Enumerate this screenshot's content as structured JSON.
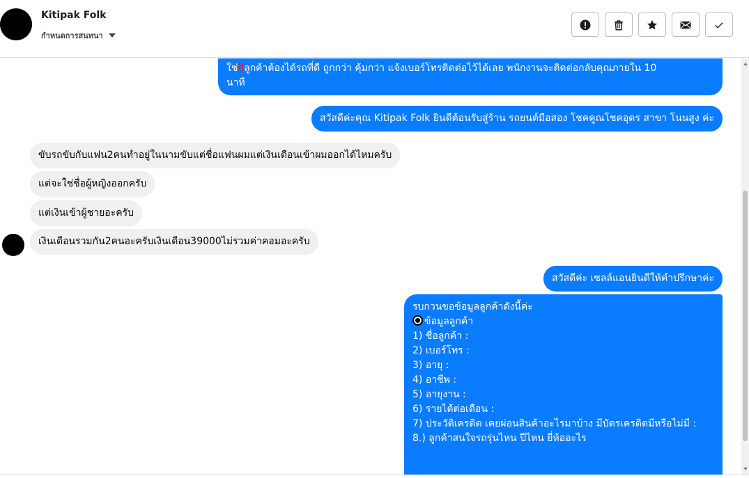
{
  "header": {
    "contact_name": "Kitipak Folk",
    "assign_label": "กำหนดการสนทนา",
    "actions": [
      "alert-icon",
      "trash-icon",
      "star-icon",
      "mail-icon",
      "check-icon"
    ]
  },
  "messages": {
    "m1_line1_pre": "ใช่",
    "m1_excl": "‼",
    "m1_line1_post": "ลูกค้าต้องได้รถที่ดี ถูกกว่า คุ้มกว่า แจ้งเบอร์โทรติดต่อไว้ได้เลย พนักงานจะติดต่อกลับคุณภายใน 10",
    "m1_line2": "นาที",
    "m2": "สวัสดีค่ะคุณ Kitipak Folk ยินดีต้อนรับสู่ร้าน รถยนต์มือสอง โชคคูณโชคอุดร สาขา โนนสูง ค่ะ",
    "m3": "ขับรถขับกับแฟน2คนทำอยู่ในนามขับแต่ชื่อแฟนผมแต่เงินเดือนเข้าผมออกได้ไหมครับ",
    "m4": "แต่จะใช่ชื่อผู้หญิงออกครับ",
    "m5": "แต่เงินเข้าผู้ชายอะครับ",
    "m6": "เงินเดือนรวมกัน2คนอะครับเงินเดือน39000ไม่รวมค่าคอมอะครับ",
    "m7": "สวัสดีค่ะ เซลล์แอนยินดีให้คำปรึกษาค่ะ",
    "m8": {
      "line0": "รบกวนขอข้อมูลลูกค้าดังนี้ค่ะ",
      "line1": "ข้อมูลลูกค้า",
      "items": [
        "1) ชื่อลูกค้า :",
        "2) เบอร์โทร :",
        "3) อายุ :",
        "4) อาชีพ :",
        "5) อายุงาน :",
        "6) รายได้ต่อเดือน :",
        "7) ประวัติเครดิต  เคยผ่อนสินค้าอะไรมาบ้าง มีบัตรเครดิตมีหรือไม่มี :",
        "8.) ลูกค้าสนใจรถรุ่นไหน ปีไหน ยี่ห้ออะไร"
      ]
    }
  },
  "colors": {
    "outgoing": "#0a7cff",
    "incoming": "#f0f0f0",
    "alert": "#e0263b"
  }
}
